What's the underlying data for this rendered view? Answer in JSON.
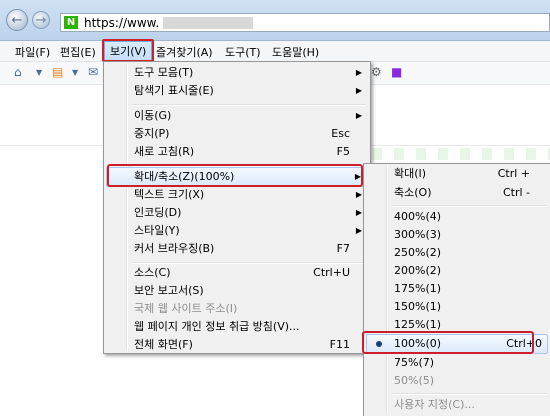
{
  "window": {
    "url": "https://www.",
    "favicon_letter": "N"
  },
  "menubar": [
    {
      "label": "파일(F)"
    },
    {
      "label": "편집(E)"
    },
    {
      "label": "보기(V)"
    },
    {
      "label": "즐겨찾기(A)"
    },
    {
      "label": "도구(T)"
    },
    {
      "label": "도움말(H)"
    }
  ],
  "view_menu": {
    "items": [
      {
        "label": "도구 모음(T)",
        "shortcut": "",
        "submenu": true
      },
      {
        "label": "탐색기 표시줄(E)",
        "shortcut": "",
        "submenu": true
      },
      {
        "label": "이동(G)",
        "shortcut": "",
        "submenu": true
      },
      {
        "label": "중지(P)",
        "shortcut": "Esc"
      },
      {
        "label": "새로 고침(R)",
        "shortcut": "F5"
      },
      {
        "label": "확대/축소(Z)(100%)",
        "shortcut": "",
        "submenu": true,
        "highlighted": true
      },
      {
        "label": "텍스트 크기(X)",
        "shortcut": "",
        "submenu": true
      },
      {
        "label": "인코딩(D)",
        "shortcut": "",
        "submenu": true
      },
      {
        "label": "스타일(Y)",
        "shortcut": "",
        "submenu": true
      },
      {
        "label": "커서 브라우징(B)",
        "shortcut": "F7"
      },
      {
        "label": "소스(C)",
        "shortcut": "Ctrl+U"
      },
      {
        "label": "보안 보고서(S)",
        "shortcut": ""
      },
      {
        "label": "국제 웹 사이트 주소(I)",
        "shortcut": "",
        "disabled": true
      },
      {
        "label": "웹 페이지 개인 정보 취급 방침(V)...",
        "shortcut": ""
      },
      {
        "label": "전체 화면(F)",
        "shortcut": "F11"
      }
    ]
  },
  "zoom_menu": {
    "items": [
      {
        "label": "확대(I)",
        "shortcut": "Ctrl +"
      },
      {
        "label": "축소(O)",
        "shortcut": "Ctrl -"
      },
      {
        "label": "400%(4)",
        "shortcut": ""
      },
      {
        "label": "300%(3)",
        "shortcut": ""
      },
      {
        "label": "250%(2)",
        "shortcut": ""
      },
      {
        "label": "200%(2)",
        "shortcut": ""
      },
      {
        "label": "175%(1)",
        "shortcut": ""
      },
      {
        "label": "150%(1)",
        "shortcut": ""
      },
      {
        "label": "125%(1)",
        "shortcut": ""
      },
      {
        "label": "100%(0)",
        "shortcut": "Ctrl+0",
        "selected": true
      },
      {
        "label": "75%(7)",
        "shortcut": ""
      },
      {
        "label": "50%(5)",
        "shortcut": "",
        "disabled": true
      },
      {
        "label": "사용자 지정(C)...",
        "shortcut": "",
        "disabled": true
      }
    ]
  },
  "colors": {
    "highlight_border": "#cc1f2b",
    "menu_bg": "#f0f0f0",
    "naver_green": "#2db400"
  }
}
